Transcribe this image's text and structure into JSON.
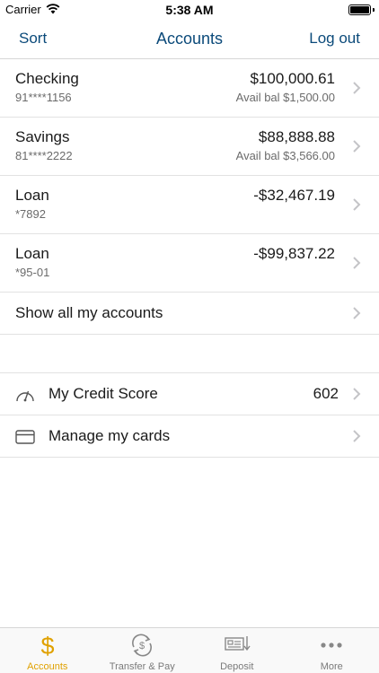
{
  "status_bar": {
    "carrier": "Carrier",
    "time": "5:38 AM",
    "battery_level": 1.0
  },
  "nav": {
    "left": "Sort",
    "title": "Accounts",
    "right": "Log out"
  },
  "accounts": [
    {
      "name": "Checking",
      "number": "91****1156",
      "amount": "$100,000.61",
      "available": "Avail bal $1,500.00"
    },
    {
      "name": "Savings",
      "number": "81****2222",
      "amount": "$88,888.88",
      "available": "Avail bal $3,566.00"
    },
    {
      "name": "Loan",
      "number": "*7892",
      "amount": "-$32,467.19",
      "available": ""
    },
    {
      "name": "Loan",
      "number": "*95-01",
      "amount": "-$99,837.22",
      "available": ""
    }
  ],
  "show_all": "Show all my accounts",
  "extras": {
    "credit": {
      "icon": "gauge-icon",
      "label": "My Credit Score",
      "value": "602"
    },
    "cards": {
      "icon": "credit-card-icon",
      "label": "Manage my cards"
    }
  },
  "tabs": [
    {
      "label": "Accounts",
      "icon": "dollar-icon",
      "active": true
    },
    {
      "label": "Transfer & Pay",
      "icon": "transfer-icon",
      "active": false
    },
    {
      "label": "Deposit",
      "icon": "check-deposit-icon",
      "active": false
    },
    {
      "label": "More",
      "icon": "more-dots-icon",
      "active": false
    }
  ],
  "colors": {
    "nav_text": "#0b4a7a",
    "active_tab": "#e0a100",
    "inactive_tab": "#7a7a7a"
  }
}
